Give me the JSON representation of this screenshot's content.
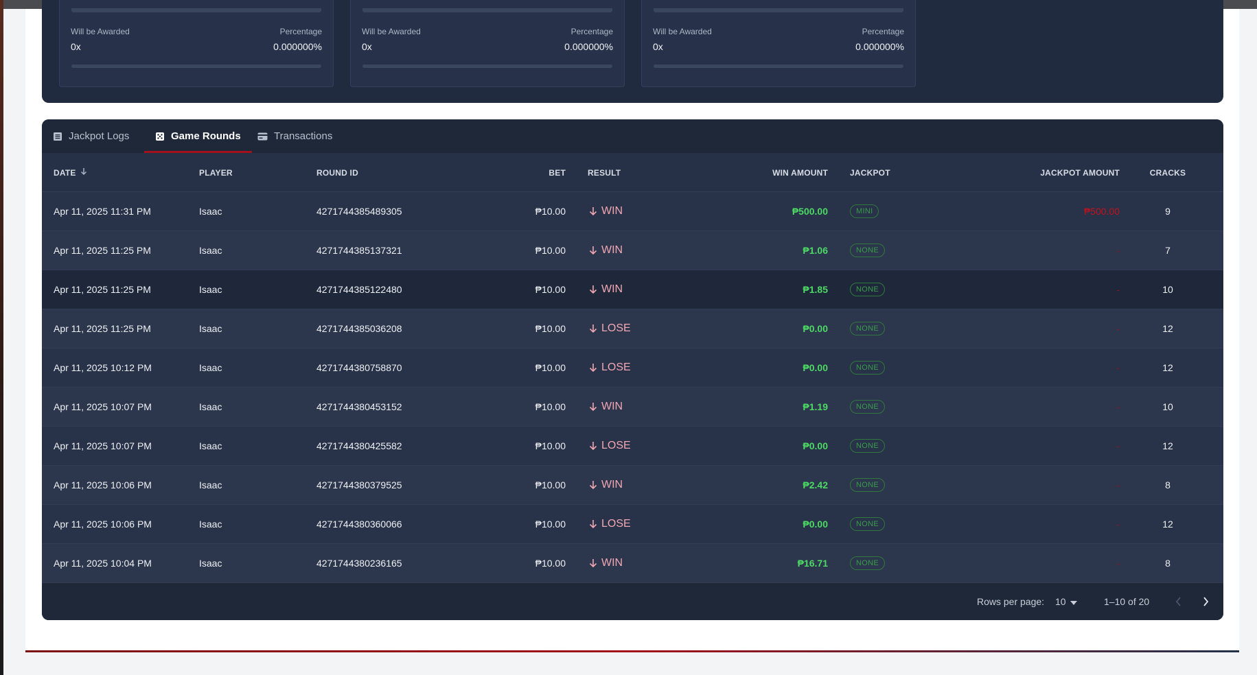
{
  "jackpot_cards": [
    {
      "awarded_label": "Will be Awarded",
      "awarded_value": "0x",
      "percentage_label": "Percentage",
      "percentage_value": "0.000000%",
      "progress": 0
    },
    {
      "awarded_label": "Will be Awarded",
      "awarded_value": "0x",
      "percentage_label": "Percentage",
      "percentage_value": "0.000000%",
      "progress": 0
    },
    {
      "awarded_label": "Will be Awarded",
      "awarded_value": "0x",
      "percentage_label": "Percentage",
      "percentage_value": "0.000000%",
      "progress": 0
    }
  ],
  "tabs": [
    {
      "label": "Jackpot Logs",
      "icon": "list-icon",
      "active": false
    },
    {
      "label": "Game Rounds",
      "icon": "dice-icon",
      "active": true
    },
    {
      "label": "Transactions",
      "icon": "card-icon",
      "active": false
    }
  ],
  "columns": {
    "date": "DATE",
    "player": "PLAYER",
    "round_id": "ROUND ID",
    "bet": "BET",
    "result": "RESULT",
    "win_amount": "WIN AMOUNT",
    "jackpot": "JACKPOT",
    "jackpot_amount": "JACKPOT AMOUNT",
    "cracks": "CRACKS"
  },
  "sort": {
    "column": "date",
    "direction": "desc",
    "icon": "arrow-down-icon"
  },
  "rows": [
    {
      "date": "Apr 11, 2025 11:31 PM",
      "player": "Isaac",
      "round_id": "4271744385489305",
      "bet": "₱10.00",
      "result": "WIN",
      "win_amount": "₱500.00",
      "jackpot": "MINI",
      "jackpot_amount": "₱500.00",
      "cracks": "9"
    },
    {
      "date": "Apr 11, 2025 11:25 PM",
      "player": "Isaac",
      "round_id": "4271744385137321",
      "bet": "₱10.00",
      "result": "WIN",
      "win_amount": "₱1.06",
      "jackpot": "NONE",
      "jackpot_amount": "-",
      "cracks": "7"
    },
    {
      "date": "Apr 11, 2025 11:25 PM",
      "player": "Isaac",
      "round_id": "4271744385122480",
      "bet": "₱10.00",
      "result": "WIN",
      "win_amount": "₱1.85",
      "jackpot": "NONE",
      "jackpot_amount": "-",
      "cracks": "10"
    },
    {
      "date": "Apr 11, 2025 11:25 PM",
      "player": "Isaac",
      "round_id": "4271744385036208",
      "bet": "₱10.00",
      "result": "LOSE",
      "win_amount": "₱0.00",
      "jackpot": "NONE",
      "jackpot_amount": "-",
      "cracks": "12"
    },
    {
      "date": "Apr 11, 2025 10:12 PM",
      "player": "Isaac",
      "round_id": "4271744380758870",
      "bet": "₱10.00",
      "result": "LOSE",
      "win_amount": "₱0.00",
      "jackpot": "NONE",
      "jackpot_amount": "-",
      "cracks": "12"
    },
    {
      "date": "Apr 11, 2025 10:07 PM",
      "player": "Isaac",
      "round_id": "4271744380453152",
      "bet": "₱10.00",
      "result": "WIN",
      "win_amount": "₱1.19",
      "jackpot": "NONE",
      "jackpot_amount": "-",
      "cracks": "10"
    },
    {
      "date": "Apr 11, 2025 10:07 PM",
      "player": "Isaac",
      "round_id": "4271744380425582",
      "bet": "₱10.00",
      "result": "LOSE",
      "win_amount": "₱0.00",
      "jackpot": "NONE",
      "jackpot_amount": "-",
      "cracks": "12"
    },
    {
      "date": "Apr 11, 2025 10:06 PM",
      "player": "Isaac",
      "round_id": "4271744380379525",
      "bet": "₱10.00",
      "result": "WIN",
      "win_amount": "₱2.42",
      "jackpot": "NONE",
      "jackpot_amount": "-",
      "cracks": "8"
    },
    {
      "date": "Apr 11, 2025 10:06 PM",
      "player": "Isaac",
      "round_id": "4271744380360066",
      "bet": "₱10.00",
      "result": "LOSE",
      "win_amount": "₱0.00",
      "jackpot": "NONE",
      "jackpot_amount": "-",
      "cracks": "12"
    },
    {
      "date": "Apr 11, 2025 10:04 PM",
      "player": "Isaac",
      "round_id": "4271744380236165",
      "bet": "₱10.00",
      "result": "WIN",
      "win_amount": "₱16.71",
      "jackpot": "NONE",
      "jackpot_amount": "-",
      "cracks": "8"
    }
  ],
  "pagination": {
    "rows_per_page_label": "Rows per page:",
    "rows_per_page_value": "10",
    "range_text": "1–10 of 20",
    "prev_icon": "chevron-left-icon",
    "next_icon": "chevron-right-icon"
  },
  "colors": {
    "accent_red": "#a3111a",
    "win_green": "#4cd964",
    "result_pink": "#f2a7b3",
    "panel_bg": "#232c40"
  }
}
